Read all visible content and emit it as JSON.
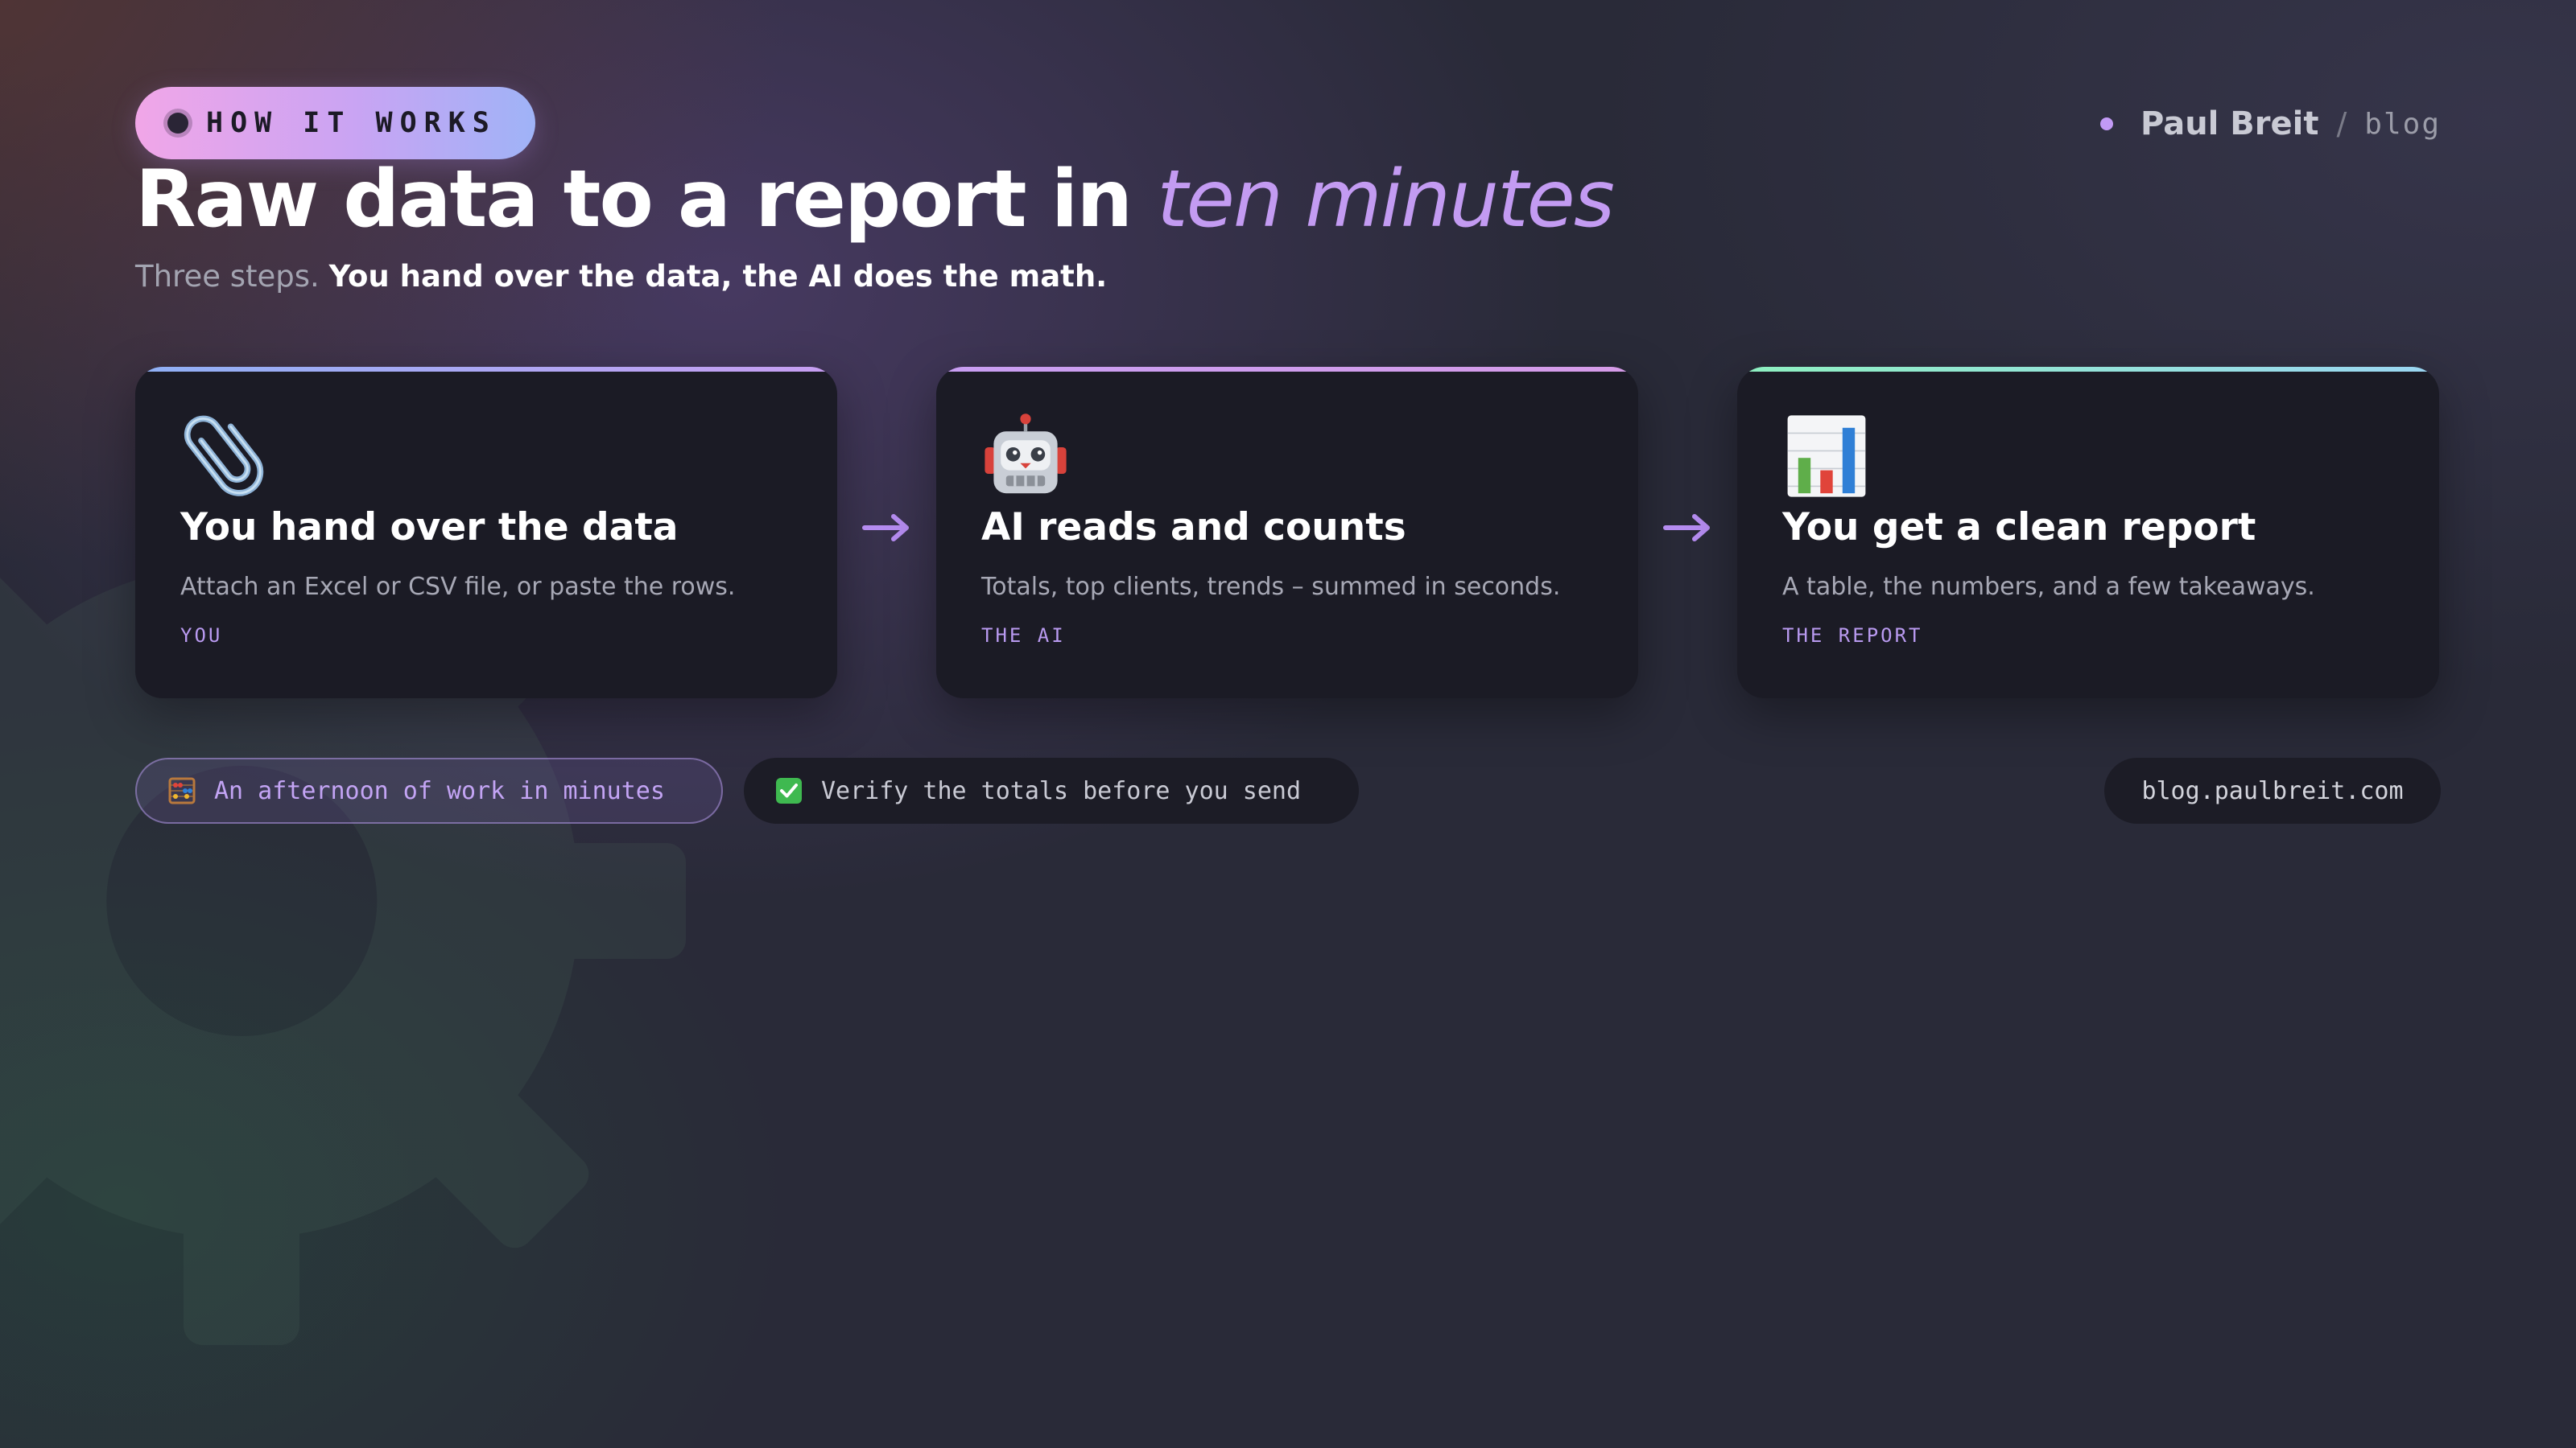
{
  "header": {
    "badge": "HOW IT WORKS",
    "title_main": "Raw data to a report in ",
    "title_accent": "ten minutes",
    "subtitle_lead": "Three steps. ",
    "subtitle_strong": "You hand over the data, the AI does the math."
  },
  "brand": {
    "name": "Paul Breit",
    "separator": "/",
    "section": "blog"
  },
  "steps": [
    {
      "icon": "paperclip-icon",
      "title": "You hand over the data",
      "description": "Attach an Excel or CSV file, or paste the rows.",
      "tag": "YOU",
      "accent_colors": [
        "#8fb0f5",
        "#c89ef2"
      ]
    },
    {
      "icon": "robot-icon",
      "title": "AI reads and counts",
      "description": "Totals, top clients, trends – summed in seconds.",
      "tag": "THE AI",
      "accent_colors": [
        "#c89ef2",
        "#d69ce8"
      ]
    },
    {
      "icon": "bar-chart-icon",
      "title": "You get a clean report",
      "description": "A table, the numbers, and a few takeaways.",
      "tag": "THE REPORT",
      "accent_colors": [
        "#8ef0c0",
        "#9bd6f3"
      ]
    }
  ],
  "pills": [
    {
      "icon": "abacus-icon",
      "text": "An afternoon of work in minutes"
    },
    {
      "icon": "check-mark-icon",
      "text": "Verify the totals before you send"
    },
    {
      "icon": "",
      "text": "blog.paulbreit.com"
    }
  ],
  "colors": {
    "accent": "#c39bf2",
    "background": "#292a38",
    "card": "#1b1b25"
  }
}
